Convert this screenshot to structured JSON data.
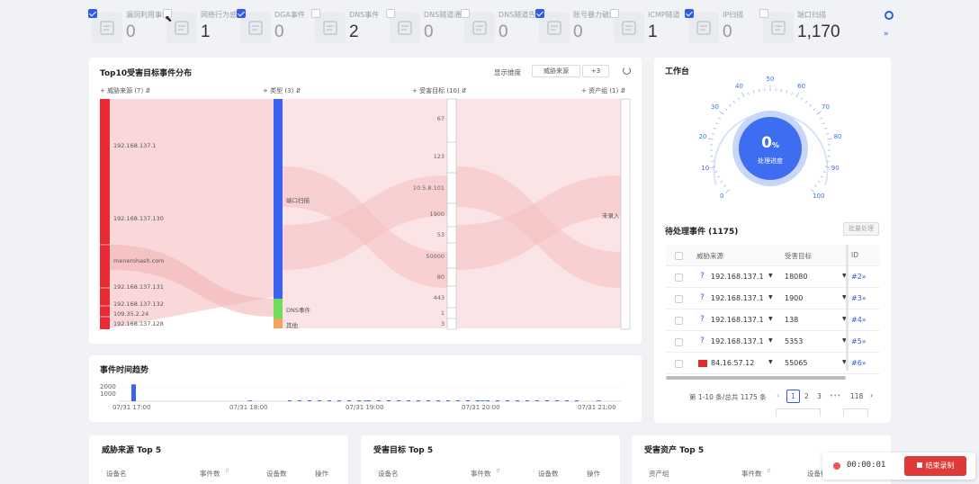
{
  "stats": [
    {
      "label": "漏洞利用事件",
      "value": "0",
      "checked": true,
      "icon": "document-icon"
    },
    {
      "label": "网络行为感知",
      "value": "1",
      "checked": false,
      "icon": "calendar-gear-icon"
    },
    {
      "label": "DGA事件",
      "value": "0",
      "checked": true,
      "icon": "alarm-icon"
    },
    {
      "label": "DNS事件",
      "value": "2",
      "checked": false,
      "icon": "dns-icon"
    },
    {
      "label": "DNS隧道通信",
      "value": "0",
      "checked": false,
      "icon": "tunnel-icon"
    },
    {
      "label": "DNS隧道告警",
      "value": "0",
      "checked": false,
      "icon": "alarm-icon"
    },
    {
      "label": "账号暴力破解",
      "value": "0",
      "checked": true,
      "icon": "database-icon"
    },
    {
      "label": "ICMP隧道",
      "value": "1",
      "checked": false,
      "icon": "tunnel-icon"
    },
    {
      "label": "IP扫描",
      "value": "0",
      "checked": true,
      "icon": "speed-icon"
    },
    {
      "label": "端口扫描",
      "value": "1,170",
      "checked": false,
      "icon": "scan-icon"
    }
  ],
  "sankey": {
    "title": "Top10受害目标事件分布",
    "display_dim_label": "显示维度",
    "display_dim_value": "威胁来源",
    "display_dim_count": "+3",
    "col_headers": [
      "威胁来源 (7)",
      "类型 (3)",
      "受害目标 (10)",
      "资产组 (1)"
    ],
    "sources": [
      "192.168.137.1",
      "192.168.137.130",
      "menerohash.com",
      "192.168.137.131",
      "192.168.137.132",
      "109.35.2.24",
      "192.168.137.128"
    ],
    "types": [
      "端口扫描",
      "DNS事件",
      "其他"
    ],
    "targets": [
      "67",
      "123",
      "10.5.8.101",
      "1900",
      "53",
      "50000",
      "80",
      "443",
      "1",
      "3"
    ],
    "groups": [
      "未录入"
    ]
  },
  "timeline": {
    "title": "事件时间趋势",
    "y_ticks": [
      "2000",
      "1000"
    ],
    "x_ticks": [
      "07/31 17:00",
      "07/31 18:00",
      "07/31 19:00",
      "07/31 20:00",
      "07/31 21:00"
    ]
  },
  "chart_data": {
    "type": "bar",
    "title": "事件时间趋势",
    "x": [
      "07/31 17:00",
      "07/31 18:00",
      "07/31 19:00",
      "07/31 20:00",
      "07/31 21:00"
    ],
    "values": [
      1170,
      0,
      0,
      0,
      0
    ],
    "ylim": [
      0,
      2000
    ]
  },
  "workbench": {
    "title": "工作台",
    "gauge_value": "0",
    "gauge_unit": "%",
    "gauge_label": "处理进度",
    "gauge_ticks": [
      "0",
      "10",
      "20",
      "30",
      "40",
      "50",
      "60",
      "70",
      "80",
      "90",
      "100"
    ],
    "pending_title": "待处理事件 (1175)",
    "batch_btn": "批量处理",
    "cols": [
      "威胁来源",
      "受害目标",
      "ID"
    ],
    "rows": [
      {
        "src": "192.168.137.1",
        "dst": "18080",
        "id": "#2»",
        "flag": false
      },
      {
        "src": "192.168.137.1",
        "dst": "1900",
        "id": "#3»",
        "flag": false
      },
      {
        "src": "192.168.137.1",
        "dst": "138",
        "id": "#4»",
        "flag": false
      },
      {
        "src": "192.168.137.1",
        "dst": "5353",
        "id": "#5»",
        "flag": false
      },
      {
        "src": "84.16.57.12",
        "dst": "55065",
        "id": "#6»",
        "flag": true
      }
    ],
    "pagination_text": "第 1-10 条/总共 1175 条",
    "pages": [
      "1",
      "2",
      "3",
      "•••",
      "118"
    ]
  },
  "bottom": [
    {
      "title": "威胁来源 Top 5",
      "cols": [
        "设备名",
        "事件数",
        "设备数",
        "操作"
      ]
    },
    {
      "title": "受害目标 Top 5",
      "cols": [
        "设备名",
        "事件数",
        "设备数",
        "操作"
      ]
    },
    {
      "title": "受害资产 Top 5",
      "cols": [
        "资产组",
        "事件数",
        "设备数"
      ]
    }
  ],
  "recorder": {
    "time": "00:00:01",
    "stop_label": "结束录制"
  },
  "colors": {
    "accent": "#2f5bea",
    "danger": "#ea2a35",
    "flow": "#f6b6b8"
  }
}
